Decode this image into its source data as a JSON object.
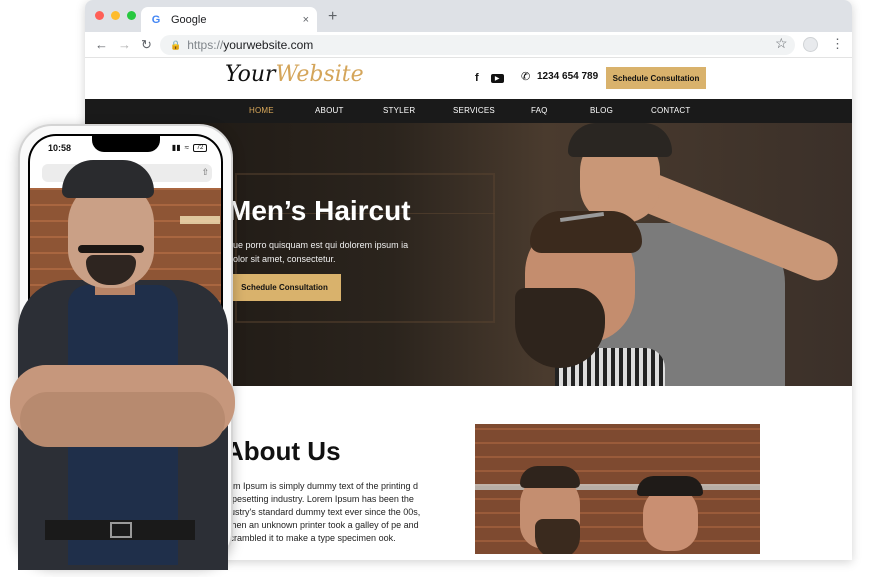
{
  "browser": {
    "tab_title": "Google",
    "tab_favicon": "G",
    "tab_close": "×",
    "new_tab": "+",
    "url_proto": "https://",
    "url_host": "yourwebsite.com"
  },
  "site": {
    "logo_part1": "Your",
    "logo_part2": "Website",
    "phone": "1234 654 789",
    "header_cta": "Schedule Consultation",
    "nav": [
      "HOME",
      "ABOUT",
      "STYLER",
      "SERVICES",
      "FAQ",
      "BLOG",
      "CONTACT"
    ],
    "hero": {
      "title": "Men’s Haircut",
      "text": "que porro quisquam est qui dolorem ipsum ia dolor sit amet, consectetur.",
      "button": "Schedule Consultation"
    },
    "about": {
      "title": "About Us",
      "text": "rem Ipsum is simply dummy text of the printing d typesetting industry. Lorem Ipsum has been the dustry's standard dummy text ever since the 00s, when an unknown printer took a galley of pe and scrambled it to make a type specimen ook."
    }
  },
  "mobile": {
    "time": "10:58",
    "battery": "72",
    "url": "om"
  },
  "colors": {
    "accent": "#d9b26c",
    "nav_bg": "#1a1a1a",
    "active_nav": "#d9a85a"
  }
}
